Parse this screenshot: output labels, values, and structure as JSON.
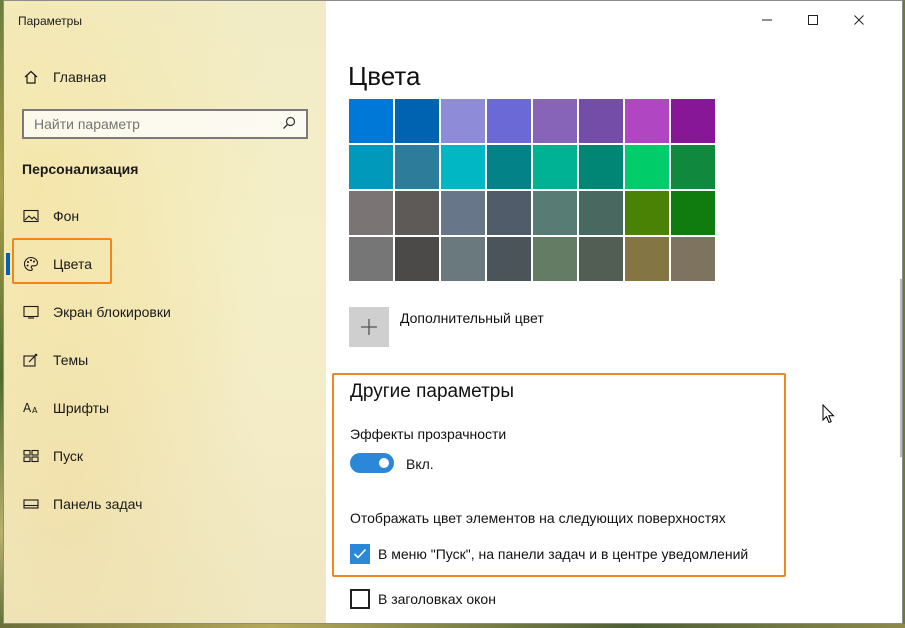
{
  "window": {
    "title": "Параметры"
  },
  "sidebar": {
    "home": {
      "label": "Главная",
      "icon": "home-icon"
    },
    "search": {
      "placeholder": "Найти параметр",
      "icon": "search-icon"
    },
    "section_title": "Персонализация",
    "items": [
      {
        "label": "Фон",
        "icon": "image-icon",
        "active": false
      },
      {
        "label": "Цвета",
        "icon": "palette-icon",
        "active": true
      },
      {
        "label": "Экран блокировки",
        "icon": "lock-screen-icon",
        "active": false
      },
      {
        "label": "Темы",
        "icon": "themes-icon",
        "active": false
      },
      {
        "label": "Шрифты",
        "icon": "fonts-icon",
        "active": false
      },
      {
        "label": "Пуск",
        "icon": "start-icon",
        "active": false
      },
      {
        "label": "Панель задач",
        "icon": "taskbar-icon",
        "active": false
      }
    ]
  },
  "main": {
    "heading": "Цвета",
    "swatches": [
      "#0078d7",
      "#0063b1",
      "#8e8cd8",
      "#6b69d6",
      "#8764b8",
      "#744da9",
      "#b146c2",
      "#881798",
      "#0099bc",
      "#2d7d9a",
      "#00b7c3",
      "#038387",
      "#00b294",
      "#018574",
      "#00cc6a",
      "#10893e",
      "#7a7574",
      "#5d5a58",
      "#68768a",
      "#515c6b",
      "#567c73",
      "#486860",
      "#498205",
      "#107c10",
      "#767676",
      "#4c4a48",
      "#69797e",
      "#4a5459",
      "#647c64",
      "#525e54",
      "#847545",
      "#7e735f"
    ],
    "custom_color_label": "Дополнительный цвет",
    "other": {
      "title": "Другие параметры",
      "transparency_label": "Эффекты прозрачности",
      "transparency_state": "Вкл.",
      "surfaces_label": "Отображать цвет элементов на следующих поверхностях",
      "checkbox_start": "В меню \"Пуск\", на панели задач и в центре уведомлений",
      "checkbox_titles": "В заголовках окон"
    }
  },
  "colors": {
    "accent": "#2b88d8",
    "highlight": "#f0861c"
  }
}
